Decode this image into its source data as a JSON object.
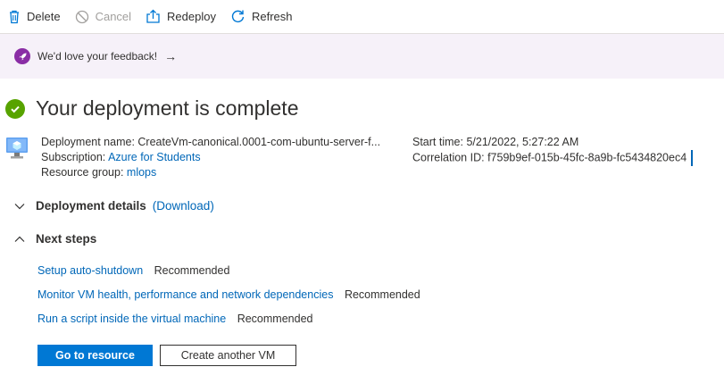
{
  "toolbar": {
    "delete_label": "Delete",
    "cancel_label": "Cancel",
    "redeploy_label": "Redeploy",
    "refresh_label": "Refresh"
  },
  "feedback": {
    "text": "We'd love your feedback!",
    "arrow": "→"
  },
  "title": "Your deployment is complete",
  "deployment": {
    "name_label": "Deployment name:",
    "name_value": "CreateVm-canonical.0001-com-ubuntu-server-f...",
    "subscription_label": "Subscription:",
    "subscription_value": "Azure for Students",
    "resource_group_label": "Resource group:",
    "resource_group_value": "mlops",
    "start_time_label": "Start time:",
    "start_time_value": "5/21/2022, 5:27:22 AM",
    "correlation_label": "Correlation ID:",
    "correlation_value": "f759b9ef-015b-45fc-8a9b-fc5434820ec4"
  },
  "sections": {
    "details_label": "Deployment details",
    "download_label": "(Download)",
    "next_steps_label": "Next steps"
  },
  "next_steps": [
    {
      "link": "Setup auto-shutdown",
      "tag": "Recommended"
    },
    {
      "link": "Monitor VM health, performance and network dependencies",
      "tag": "Recommended"
    },
    {
      "link": "Run a script inside the virtual machine",
      "tag": "Recommended"
    }
  ],
  "buttons": {
    "primary": "Go to resource",
    "secondary": "Create another VM"
  },
  "colors": {
    "accent": "#0078d4",
    "link": "#0067b8",
    "success": "#57a300",
    "feedback_bg": "#f6f1f9",
    "rocket": "#8a2da5"
  }
}
